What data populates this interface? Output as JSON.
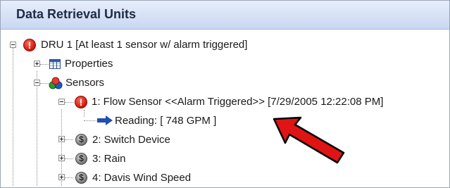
{
  "header": {
    "title": "Data Retrieval Units"
  },
  "tree": {
    "root": {
      "label": "DRU 1  [At least 1 sensor w/ alarm triggered]"
    },
    "properties": {
      "label": "Properties"
    },
    "sensors": {
      "label": "Sensors"
    },
    "flow_sensor": {
      "label": "1: Flow Sensor  <<Alarm Triggered>> [7/29/2005 12:22:08 PM]"
    },
    "reading": {
      "label": "Reading: [ 748 GPM ]"
    },
    "switch_device": {
      "label": "2: Switch Device"
    },
    "rain": {
      "label": "3: Rain"
    },
    "wind": {
      "label": "4: Davis Wind Speed"
    }
  },
  "annotation": {
    "arrow_color": "#e01414"
  }
}
